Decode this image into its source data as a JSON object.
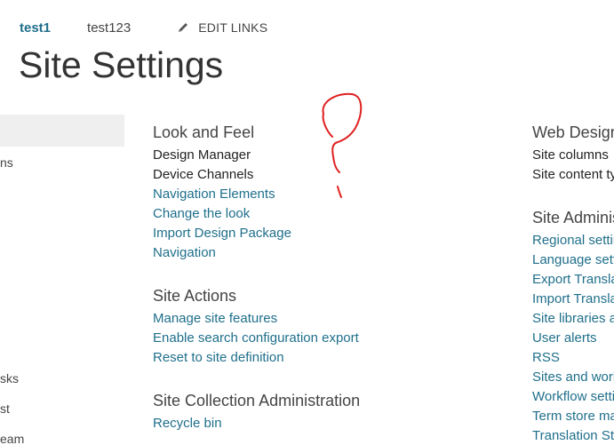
{
  "topnav": {
    "links": [
      "test1",
      "test123"
    ],
    "edit_links_label": "EDIT LINKS"
  },
  "page": {
    "title": "Site Settings"
  },
  "leftnav": {
    "partial_items": [
      "ns",
      "sks",
      "st",
      "eam"
    ]
  },
  "columns": {
    "col1": {
      "look_and_feel": {
        "title": "Look and Feel",
        "links": [
          "Design Manager",
          "Device Channels",
          "Navigation Elements",
          "Change the look",
          "Import Design Package",
          "Navigation"
        ]
      },
      "site_actions": {
        "title": "Site Actions",
        "links": [
          "Manage site features",
          "Enable search configuration export",
          "Reset to site definition"
        ]
      },
      "site_collection_admin": {
        "title": "Site Collection Administration",
        "links": [
          "Recycle bin"
        ]
      }
    },
    "col2": {
      "web_designer": {
        "title": "Web Designer Galleries",
        "links": [
          "Site columns",
          "Site content types"
        ]
      },
      "site_admin": {
        "title": "Site Administration",
        "links": [
          "Regional settings",
          "Language settings",
          "Export Translations",
          "Import Translations",
          "Site libraries and lists",
          "User alerts",
          "RSS",
          "Sites and workspaces",
          "Workflow settings",
          "Term store management",
          "Translation Status"
        ]
      }
    }
  },
  "colors": {
    "link": "#1f6f8b",
    "heading": "#444444",
    "annotation": "#e02020"
  }
}
